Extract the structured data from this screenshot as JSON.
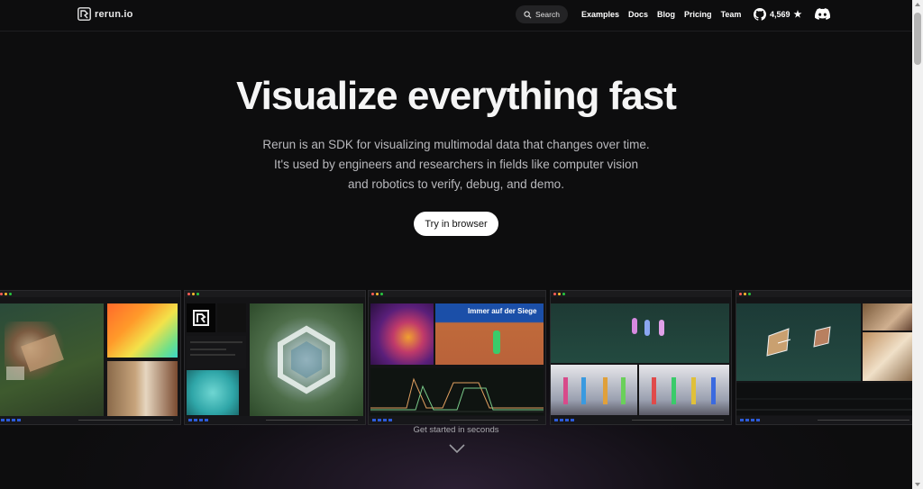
{
  "nav": {
    "brand": "rerun.io",
    "search_label": "Search",
    "links": [
      "Examples",
      "Docs",
      "Blog",
      "Pricing",
      "Team"
    ],
    "github_stars": "4,569"
  },
  "hero": {
    "title": "Visualize everything fast",
    "subtitle_lines": [
      "Rerun is an SDK for visualizing multimodal data that changes over time.",
      "It's used by engineers and researchers in fields like computer vision",
      "and robotics to verify, debug, and demo."
    ],
    "cta_label": "Try in browser"
  },
  "showcase": {
    "caption": "Get started in seconds"
  },
  "colors": {
    "accent_blue": "#2d5bd8",
    "background": "#0d0d0e"
  }
}
